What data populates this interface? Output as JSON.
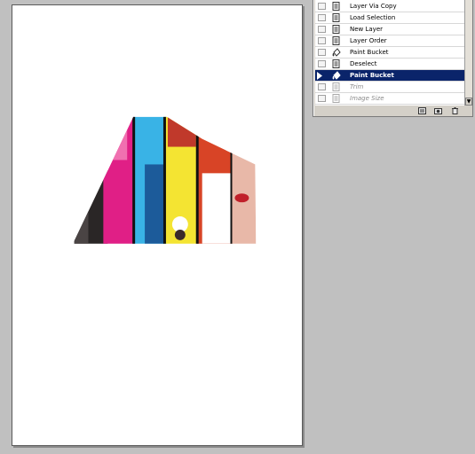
{
  "history_panel": {
    "items": [
      {
        "label": "Layer Via Copy",
        "icon": "document-history-icon"
      },
      {
        "label": "Load Selection",
        "icon": "document-history-icon"
      },
      {
        "label": "New Layer",
        "icon": "document-history-icon"
      },
      {
        "label": "Layer Order",
        "icon": "document-history-icon"
      },
      {
        "label": "Paint Bucket",
        "icon": "paint-bucket-icon"
      },
      {
        "label": "Deselect",
        "icon": "document-history-icon"
      },
      {
        "label": "Paint Bucket",
        "icon": "paint-bucket-icon",
        "selected": true
      },
      {
        "label": "Trim",
        "icon": "document-history-icon",
        "dimmed": true
      },
      {
        "label": "Image Size",
        "icon": "document-history-icon",
        "dimmed": true
      }
    ],
    "footer_icons": [
      "new-document-from-state-icon",
      "new-snapshot-icon",
      "delete-state-icon"
    ]
  },
  "colors": {
    "selection": "#0a246a",
    "workspace": "#c0c0c0",
    "panel": "#d4d0c8"
  }
}
